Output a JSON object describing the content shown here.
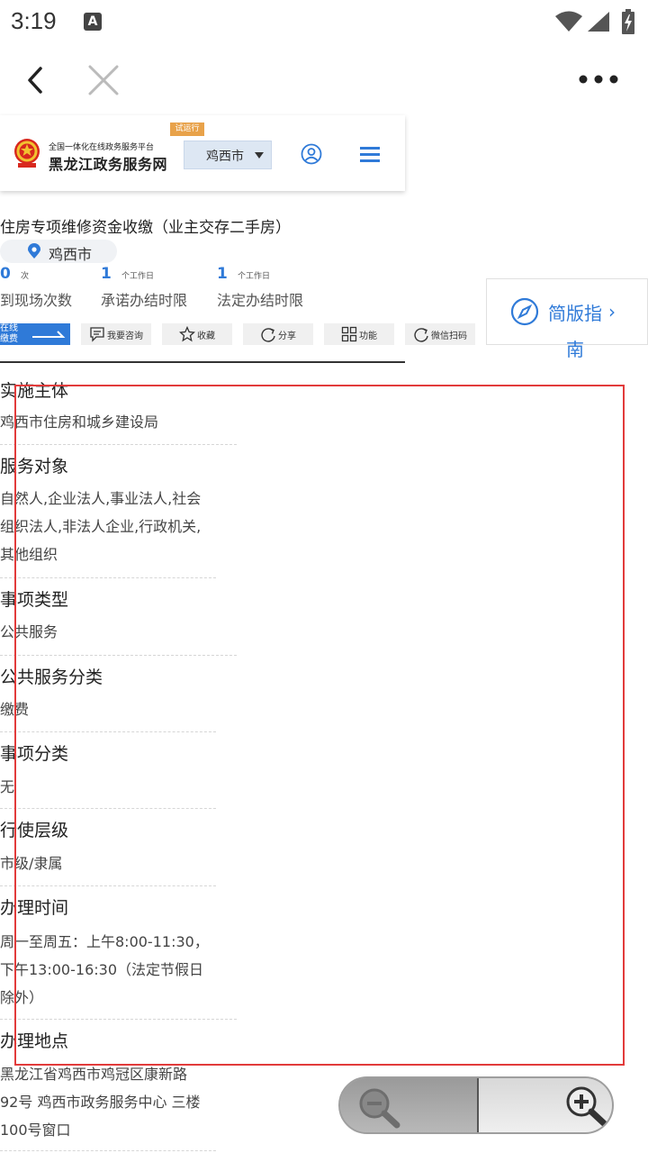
{
  "status_bar": {
    "time": "3:19",
    "notification_icon": "A"
  },
  "toolbar": {
    "back_icon": "chevron-left",
    "close_icon": "close-x",
    "more_icon": "more-dots"
  },
  "site_header": {
    "subtitle": "全国一体化在线政务服务平台",
    "title": "黑龙江政务服务网",
    "badge": "试运行",
    "city_select": "鸡西市"
  },
  "service": {
    "title": "住房专项维修资金收缴（业主交存二手房）",
    "location": "鸡西市",
    "stats": [
      {
        "value": "0",
        "unit": "次",
        "label": "到现场次数"
      },
      {
        "value": "1",
        "unit": "个工作日",
        "label": "承诺办结时限"
      },
      {
        "value": "1",
        "unit": "个工作日",
        "label": "法定办结时限"
      }
    ]
  },
  "guide": {
    "label_line1": "简版指",
    "label_line2": "南",
    "chevron": "›"
  },
  "actions": {
    "pay": {
      "line1": "在线",
      "line2": "缴费"
    },
    "items": [
      {
        "label": "我要咨询"
      },
      {
        "label": "收藏"
      },
      {
        "label": "分享"
      },
      {
        "label": "功能"
      },
      {
        "label": "微信扫码"
      }
    ]
  },
  "info": [
    {
      "label": "实施主体",
      "value": [
        "鸡西市住房和城乡建设局"
      ]
    },
    {
      "label": "服务对象",
      "value": [
        "自然人,企业法人,事业法人,社会",
        "组织法人,非法人企业,行政机关,",
        "其他组织"
      ]
    },
    {
      "label": "事项类型",
      "value": [
        "公共服务"
      ]
    },
    {
      "label": "公共服务分类",
      "value": [
        "缴费"
      ]
    },
    {
      "label": "事项分类",
      "value": [
        "无"
      ]
    },
    {
      "label": "行使层级",
      "value": [
        "市级/隶属"
      ]
    },
    {
      "label": "办理时间",
      "value": [
        "周一至周五：上午8:00-11:30，",
        "下午13:00-16:30（法定节假日",
        "除外）"
      ]
    },
    {
      "label": "办理地点",
      "value": [
        "黑龙江省鸡西市鸡冠区康新路",
        "92号 鸡西市政务服务中心 三楼",
        "100号窗口"
      ]
    }
  ],
  "colors": {
    "accent": "#2f7ad8",
    "highlight": "#e23b3b",
    "badge": "#e8a24a"
  }
}
